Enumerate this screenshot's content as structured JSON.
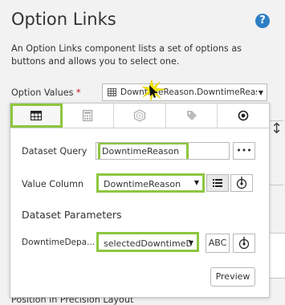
{
  "page": {
    "title": "Option Links",
    "help_icon": "?",
    "description": "An Option Links component lists a set of options as buttons and allows you to select one.",
    "option_values_label": "Option Values",
    "required_mark": "*",
    "option_values_value": "DowntimeReason.DowntimeReas",
    "bottom_partial_text": "Position in Precision Layout"
  },
  "tabs": [
    {
      "name": "dataset-tab",
      "icon": "table-icon",
      "active": true
    },
    {
      "name": "static-list-tab",
      "icon": "calculator-icon",
      "active": false
    },
    {
      "name": "cube-tab",
      "icon": "cube-icon",
      "active": false
    },
    {
      "name": "tag-tab",
      "icon": "tag-icon",
      "active": false
    },
    {
      "name": "property-tab",
      "icon": "radio-target-icon",
      "active": false
    }
  ],
  "form": {
    "dataset_query_label": "Dataset Query",
    "dataset_query_value": "DowntimeReason",
    "more_button": "•••",
    "value_column_label": "Value Column",
    "value_column_value": "DowntimeReason",
    "dataset_parameters_heading": "Dataset Parameters",
    "param_label": "DowntimeDepa...",
    "param_value": "selectedDowntimeDep",
    "abc_button": "ABC",
    "preview_button": "Preview"
  },
  "colors": {
    "highlight": "#8dc63f",
    "help_blue": "#2f7fc4",
    "required_red": "#d0021b"
  }
}
